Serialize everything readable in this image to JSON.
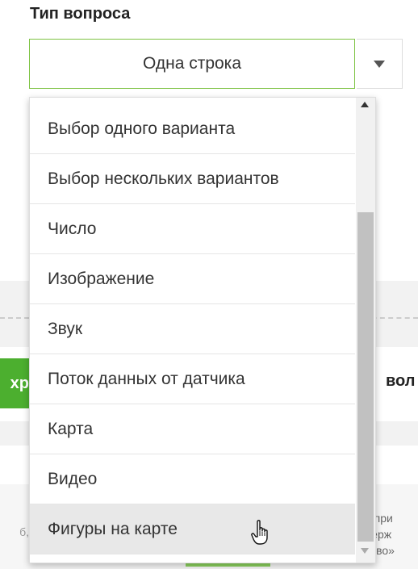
{
  "field": {
    "label": "Тип вопроса",
    "selected_value": "Одна строка"
  },
  "dropdown": {
    "options": [
      "Выбор одного варианта",
      "Выбор нескольких вариантов",
      "Число",
      "Изображение",
      "Звук",
      "Поток данных от датчика",
      "Карта",
      "Видео",
      "Фигуры на карте"
    ],
    "hovered_option": "Фигуры на карте"
  },
  "background": {
    "left_button_fragment": "хр",
    "right_heading_fragment": "вол",
    "left_small_text": "б, ",
    "right_small_lines": [
      "н при",
      "держ",
      "ково»"
    ]
  },
  "colors": {
    "accent_green": "#7cc241",
    "button_green": "#4caf2f"
  }
}
